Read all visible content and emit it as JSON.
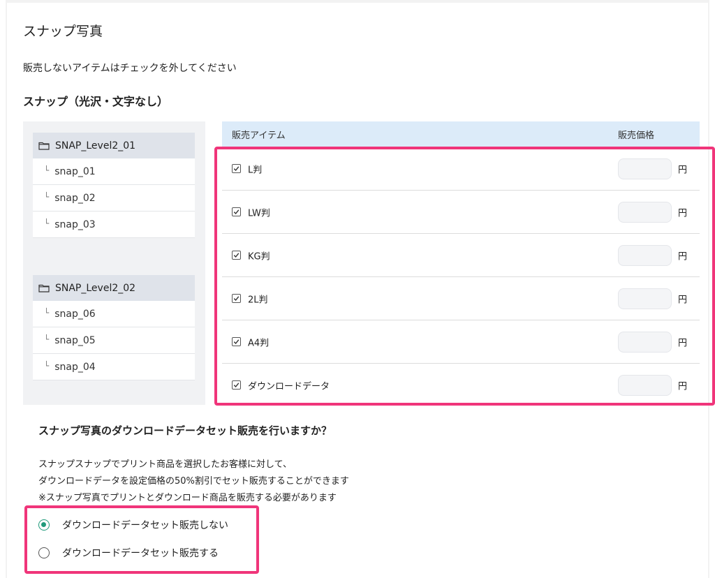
{
  "page": {
    "title": "スナップ写真",
    "instruction": "販売しないアイテムはチェックを外してください",
    "section_title": "スナップ（光沢・文字なし）"
  },
  "folders": [
    {
      "name": "SNAP_Level2_01",
      "items": [
        "snap_01",
        "snap_02",
        "snap_03"
      ]
    },
    {
      "name": "SNAP_Level2_02",
      "items": [
        "snap_06",
        "snap_05",
        "snap_04"
      ]
    }
  ],
  "tree_connector": "└",
  "icons": {
    "folder": "folder-icon",
    "checkbox": "checkbox-checked-icon",
    "radio": "radio-icon"
  },
  "table": {
    "header_item": "販売アイテム",
    "header_price": "販売価格",
    "currency": "円",
    "rows": [
      {
        "name": "L判",
        "checked": true,
        "price": ""
      },
      {
        "name": "LW判",
        "checked": true,
        "price": ""
      },
      {
        "name": "KG判",
        "checked": true,
        "price": ""
      },
      {
        "name": "2L判",
        "checked": true,
        "price": ""
      },
      {
        "name": "A4判",
        "checked": true,
        "price": ""
      },
      {
        "name": "ダウンロードデータ",
        "checked": true,
        "price": ""
      }
    ]
  },
  "download_set": {
    "question": "スナップ写真のダウンロードデータセット販売を行いますか？",
    "desc_lines": [
      "スナップスナップでプリント商品を選択したお客様に対して、",
      "ダウンロードデータを設定価格の50%割引でセット販売することができます",
      "※スナップ写真でプリントとダウンロード商品を販売する必要があります"
    ],
    "options": [
      {
        "label": "ダウンロードデータセット販売しない",
        "selected": true
      },
      {
        "label": "ダウンロードデータセット販売する",
        "selected": false
      }
    ]
  },
  "colors": {
    "highlight": "#f0357a",
    "radio_selected": "#1f9a7a",
    "table_header": "#dcebf9",
    "panel_bg": "#f1f2f4"
  }
}
